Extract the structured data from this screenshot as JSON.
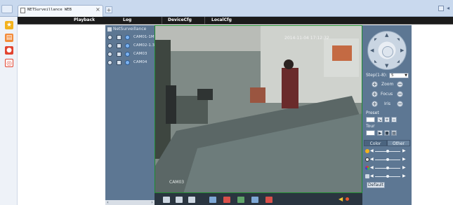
{
  "browser": {
    "tab_title": "NETSurveillance WEB",
    "tab_close": "×",
    "new_tab": "+"
  },
  "menu": {
    "items": [
      "Playback",
      "Log",
      "DeviceCfg",
      "LocalCfg"
    ]
  },
  "camlist": {
    "header": "NetSurveillance",
    "cameras": [
      "CAM01-1M",
      "CAM02-1.3",
      "CAM03",
      "CAM04"
    ]
  },
  "video": {
    "timestamp": "2014-11-04 17:12:32",
    "channel_label": "CAM03"
  },
  "ptz": {
    "step_label": "Step(1-8):",
    "step_value": "5",
    "zoom_label": "Zoom",
    "focus_label": "Focus",
    "iris_label": "Iris",
    "preset_label": "Preset",
    "tour_label": "Tour",
    "color_tab": "Color",
    "other_tab": "Other",
    "default_button": "Default"
  },
  "colors": {
    "panel": "#5d7793",
    "menubar": "#1b1b1b",
    "video_border": "#1e8b2e"
  }
}
